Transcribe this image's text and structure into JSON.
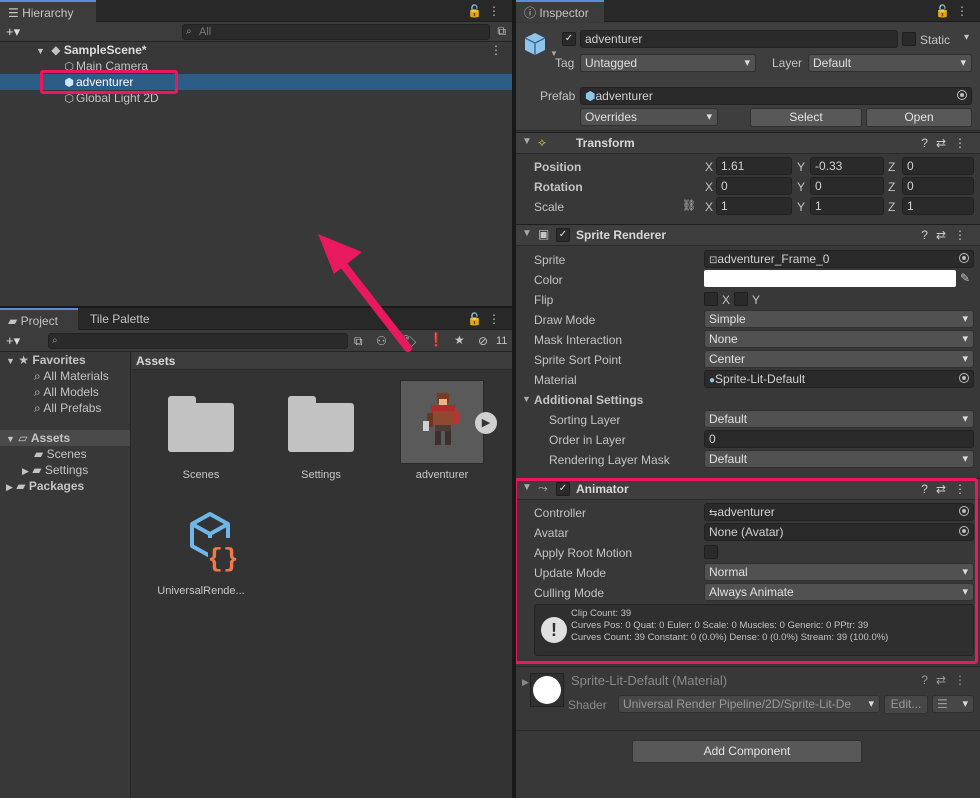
{
  "hierarchy": {
    "tab": "Hierarchy",
    "add": "+▾",
    "search_placeholder": "All",
    "scene": "SampleScene*",
    "items": [
      "Main Camera",
      "adventurer",
      "Global Light 2D"
    ]
  },
  "project": {
    "tabs": [
      "Project",
      "Tile Palette"
    ],
    "hidden_count": "11",
    "sidebar": {
      "favorites": "Favorites",
      "fav_items": [
        "All Materials",
        "All Models",
        "All Prefabs"
      ],
      "assets": "Assets",
      "asset_items": [
        "Scenes",
        "Settings"
      ],
      "packages": "Packages"
    },
    "breadcrumb": "Assets",
    "grid": [
      "Scenes",
      "Settings",
      "adventurer",
      "UniversalRende..."
    ]
  },
  "inspector": {
    "tab": "Inspector",
    "object_name": "adventurer",
    "static": "Static",
    "tag_label": "Tag",
    "tag": "Untagged",
    "layer_label": "Layer",
    "layer": "Default",
    "prefab_label": "Prefab",
    "prefab": "adventurer",
    "overrides": "Overrides",
    "select": "Select",
    "open": "Open",
    "transform": {
      "title": "Transform",
      "position_label": "Position",
      "rotation_label": "Rotation",
      "scale_label": "Scale",
      "position": [
        "1.61",
        "-0.33",
        "0"
      ],
      "rotation": [
        "0",
        "0",
        "0"
      ],
      "scale": [
        "1",
        "1",
        "1"
      ],
      "axes": [
        "X",
        "Y",
        "Z"
      ]
    },
    "sprite_renderer": {
      "title": "Sprite Renderer",
      "labels": [
        "Sprite",
        "Color",
        "Flip",
        "Draw Mode",
        "Mask Interaction",
        "Sprite Sort Point",
        "Material"
      ],
      "sprite": "adventurer_Frame_0",
      "flip_x": "X",
      "flip_y": "Y",
      "draw_mode": "Simple",
      "mask_interaction": "None",
      "sort_point": "Center",
      "material": "Sprite-Lit-Default",
      "additional": "Additional Settings",
      "sorting_layer_label": "Sorting Layer",
      "sorting_layer": "Default",
      "order_label": "Order in Layer",
      "order": "0",
      "rendering_mask_label": "Rendering Layer Mask",
      "rendering_mask": "Default"
    },
    "animator": {
      "title": "Animator",
      "labels": [
        "Controller",
        "Avatar",
        "Apply Root Motion",
        "Update Mode",
        "Culling Mode"
      ],
      "controller": "adventurer",
      "avatar": "None (Avatar)",
      "update_mode": "Normal",
      "culling_mode": "Always Animate",
      "info": [
        "Clip Count: 39",
        "Curves Pos: 0 Quat: 0 Euler: 0 Scale: 0 Muscles: 0 Generic: 0 PPtr: 39",
        "Curves Count: 39 Constant: 0 (0.0%) Dense: 0 (0.0%) Stream: 39 (100.0%)"
      ]
    },
    "material": {
      "title": "Sprite-Lit-Default (Material)",
      "shader_label": "Shader",
      "shader": "Universal Render Pipeline/2D/Sprite-Lit-De",
      "edit": "Edit..."
    },
    "add_component": "Add Component"
  },
  "colors": {
    "highlight": "#e8195e",
    "selection": "#2c5d87"
  }
}
